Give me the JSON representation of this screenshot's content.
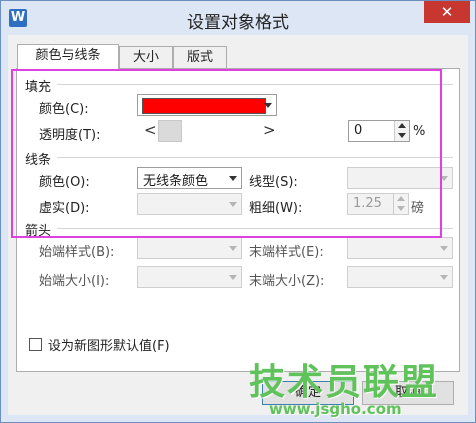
{
  "window": {
    "app_icon": "W",
    "title": "设置对象格式",
    "close_glyph": "✕"
  },
  "tabs": [
    {
      "label": "颜色与线条",
      "active": true
    },
    {
      "label": "大小",
      "active": false
    },
    {
      "label": "版式",
      "active": false
    }
  ],
  "fill": {
    "section_title": "填充",
    "color_label": "颜色(C):",
    "color_value": "#ff0000",
    "transparency_label": "透明度(T):",
    "transparency_value": "0",
    "transparency_unit": "%",
    "slider_left": "<",
    "slider_right": ">"
  },
  "line": {
    "section_title": "线条",
    "color_label": "颜色(O):",
    "color_value": "无线条颜色",
    "type_label": "线型(S):",
    "dash_label": "虚实(D):",
    "weight_label": "粗细(W):",
    "weight_value": "1.25",
    "weight_unit": "磅"
  },
  "arrows": {
    "section_title": "箭头",
    "begin_style_label": "始端样式(B):",
    "end_style_label": "末端样式(E):",
    "begin_size_label": "始端大小(I):",
    "end_size_label": "末端大小(Z):"
  },
  "default_checkbox_label": "设为新图形默认值(F)",
  "buttons": {
    "ok": "确定",
    "cancel": "取消"
  },
  "watermark": {
    "title": "技术员联盟",
    "url": "www.jsgho.com"
  },
  "colors": {
    "accent_highlight": "#e040e0",
    "fill_color": "#ff0000",
    "close_button": "#c7372f"
  }
}
